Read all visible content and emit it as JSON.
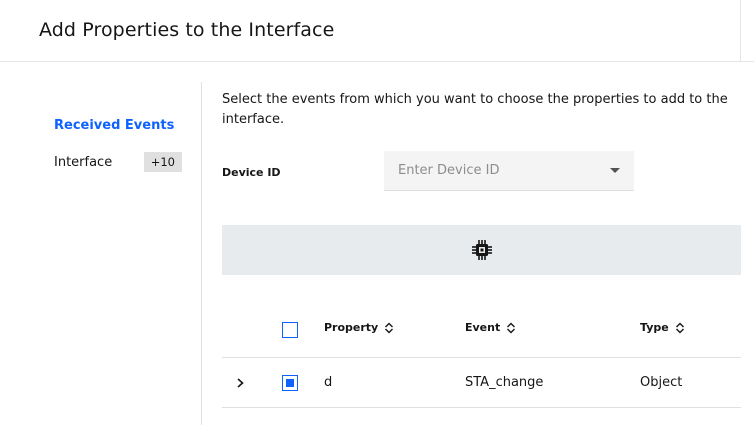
{
  "header": {
    "title": "Add Properties to the Interface"
  },
  "sidebar": {
    "heading": "Received Events",
    "items": [
      {
        "label": "Interface",
        "badge": "+10"
      }
    ]
  },
  "main": {
    "intro": "Select the events from which you want to choose the properties to add to the interface.",
    "device_id": {
      "label": "Device ID",
      "placeholder": "Enter Device ID"
    },
    "banner_icon": "chip-icon",
    "table": {
      "headers": {
        "property": "Property",
        "event": "Event",
        "type": "Type"
      },
      "rows": [
        {
          "property": "d",
          "event": "STA_change",
          "type": "Object",
          "selected": true
        }
      ]
    }
  },
  "colors": {
    "accent": "#0f62fe",
    "banner_bg": "#e8ebed"
  }
}
